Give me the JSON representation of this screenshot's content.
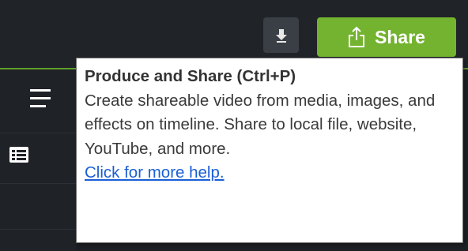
{
  "toolbar": {
    "share_label": "Share",
    "download_icon": "download-arrow-icon",
    "share_icon": "share-upload-icon",
    "accent_color": "#73b32f"
  },
  "sidebar": {
    "menu_icon": "hamburger-menu-icon",
    "list_icon": "media-list-icon"
  },
  "tooltip": {
    "title": "Produce and Share (Ctrl+P)",
    "body": "Create shareable video from media, images, and effects on timeline. Share to local file, website, YouTube, and more.",
    "help_link": "Click for more help.",
    "link_color": "#1a5fd6"
  }
}
